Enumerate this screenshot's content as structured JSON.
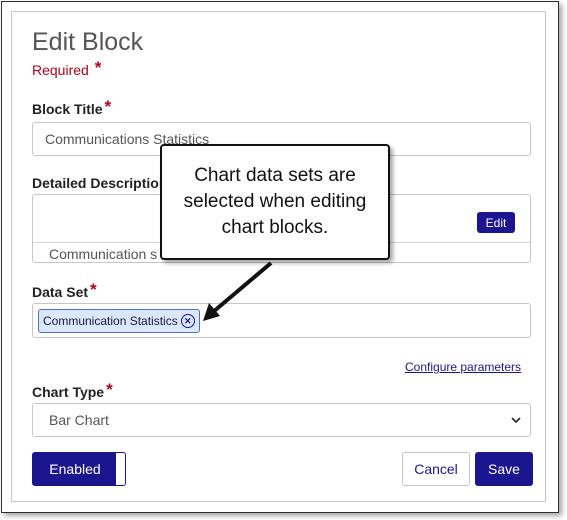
{
  "dialog": {
    "title": "Edit Block",
    "required_note": "Required",
    "required_marker": "*"
  },
  "block_title": {
    "label": "Block Title",
    "value": "Communications Statistics"
  },
  "detailed_description": {
    "label": "Detailed Description",
    "edit_label": "Edit",
    "preview_text": "Communication s"
  },
  "data_set": {
    "label": "Data Set",
    "chip_label": "Communication Statistics",
    "configure_link": "Configure parameters"
  },
  "chart_type": {
    "label": "Chart Type",
    "selected": "Bar Chart"
  },
  "footer": {
    "toggle_label": "Enabled",
    "cancel_label": "Cancel",
    "save_label": "Save"
  },
  "callout": {
    "text": "Chart data sets are selected when editing chart blocks."
  },
  "colors": {
    "primary": "#1c1590",
    "required": "#b3001b"
  }
}
